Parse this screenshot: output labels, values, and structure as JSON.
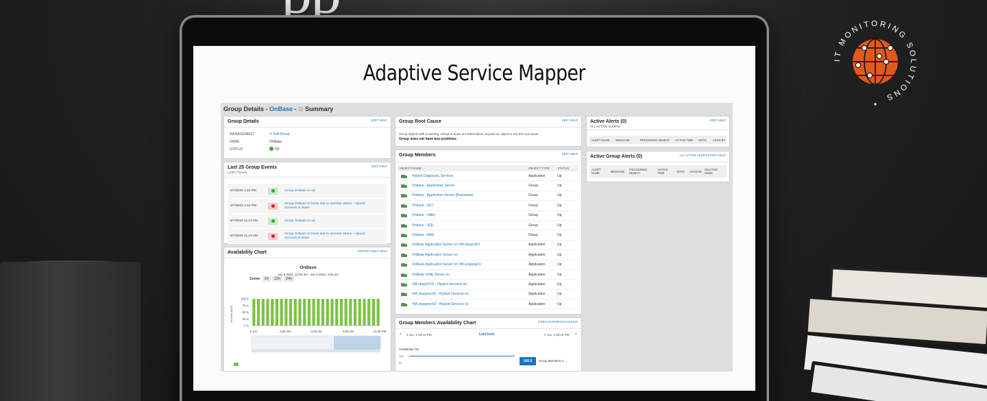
{
  "headline": "Adaptive Service Mapper",
  "bg_text": "pp",
  "logo": {
    "text": "IT MONITORING SOLUTIONS",
    "accent": "#e2591c"
  },
  "dashboard": {
    "title_prefix": "Group Details - ",
    "title_group": "OnBase",
    "title_sep": " - ",
    "title_suffix": "Summary",
    "group_details": {
      "title": "Group Details",
      "actions": "EDIT  HELP",
      "rows": [
        {
          "key": "MANAGEMENT",
          "value": "Edit Group"
        },
        {
          "key": "NAME",
          "value": "OnBase"
        },
        {
          "key": "STATUS",
          "value": "Up"
        }
      ]
    },
    "events": {
      "title": "Last 25 Group Events",
      "subtitle": "LAST 7 DAYS",
      "actions": "EDIT  HELP",
      "items": [
        {
          "time": "6/7/2024 1:18 PM",
          "state": "up",
          "message": "Group OnBase is Up."
        },
        {
          "time": "6/7/2024 1:14 PM",
          "state": "down",
          "message": "Group OnBase is Down due to member status - Hyland Services is Down"
        },
        {
          "time": "6/7/2024 11:23 AM",
          "state": "up",
          "message": "Group OnBase is Up."
        },
        {
          "time": "6/7/2024 11:19 AM",
          "state": "down",
          "message": "Group OnBase is Down due to member status - Hyland Services is Down"
        }
      ]
    },
    "availability": {
      "title": "Availability Chart",
      "actions": "EXPORT  EDIT  HELP",
      "chart_title": "OnBase",
      "range": "Jun 9 2024, 12:00 am - Jun 9 2024, 2:00 pm",
      "zoom_label": "Zoom",
      "zoom_options": [
        "1h",
        "12h",
        "24h"
      ],
      "y_label": "% AVAILABLE"
    },
    "root_cause": {
      "title": "Group Root Cause",
      "actions": "EDIT  HELP",
      "text": "Group objects with a warning, critical or down are listed below. Expand an object to see the root cause.",
      "status": "Group does not have any problems"
    },
    "members": {
      "title": "Group Members",
      "actions": "EDIT  HELP",
      "columns": [
        "OBJECT NAME",
        "OBJECT TYPE",
        "STATUS"
      ],
      "rows": [
        {
          "name": "Hyland Diagnostic Services",
          "type": "Application",
          "status": "Up"
        },
        {
          "name": "Onbase - Application Server",
          "type": "Group",
          "status": "Up"
        },
        {
          "name": "Onbase - Application Server (Brainware)",
          "type": "Group",
          "status": "Up"
        },
        {
          "name": "Onbase - NLT",
          "type": "Group",
          "status": "Up"
        },
        {
          "name": "Onbase - Utility",
          "type": "Group",
          "status": "Up"
        },
        {
          "name": "Onbase - SQL",
          "type": "Group",
          "status": "Up"
        },
        {
          "name": "Onbase - Web",
          "type": "Group",
          "status": "Up"
        },
        {
          "name": "OnBase Application Server on VM-obsprut01",
          "type": "Application",
          "status": "Up"
        },
        {
          "name": "OnBase Application Server on",
          "type": "Application",
          "status": "Up"
        },
        {
          "name": "OnBase Application Server on VM-onsprap01",
          "type": "Application",
          "status": "Up"
        },
        {
          "name": "OnBase Utility Server on",
          "type": "Application",
          "status": "Up"
        },
        {
          "name": "VM-obsphIT01 - Hyland Services on",
          "type": "Application",
          "status": "Up"
        },
        {
          "name": "VM-obspproc01 - Hyland Services on",
          "type": "Application",
          "status": "Up"
        },
        {
          "name": "VM-obspproc02 - Hyland Services on",
          "type": "Application",
          "status": "Up"
        }
      ]
    },
    "members_chart": {
      "title": "Group Members Availability Chart",
      "actions": "OPEN IN PERFSTACK  EDIT",
      "left_time": "9 Jun, 1:08:15 PM",
      "center": "Last hour",
      "right_time": "9 Jun, 2:08:15 PM",
      "y_title": "Availability (%)",
      "y_ticks": [
        "100",
        "50"
      ],
      "badge": "100.0",
      "legend": "Group Members A..."
    },
    "active_alerts": {
      "title": "Active Alerts (0)",
      "subtitle": "ALL ACTIVE ALERTS",
      "actions": "EDIT  HELP",
      "columns": [
        "ALERT NAME",
        "MESSAGE",
        "TRIGGERING OBJECT",
        "ACTIVE TIME",
        "NOTE",
        "ACKD BY"
      ]
    },
    "group_alerts": {
      "title": "Active Group Alerts (0)",
      "actions": "ALL ACTIVE ALERTS  EDIT  HELP",
      "columns": [
        "ALERT NAME",
        "MESSAGE",
        "TRIGGERING OBJECT",
        "ACTIVE TIME",
        "NOTE",
        "ACKD BY",
        "RELATED NODE"
      ]
    }
  },
  "chart_data": {
    "type": "bar",
    "title": "OnBase",
    "ylabel": "% AVAILABLE",
    "ylim": [
      0,
      100
    ],
    "y_ticks": [
      "100 %",
      "75 %",
      "50 %",
      "25 %",
      "0 %"
    ],
    "x_ticks": [
      "9 Jun",
      "3:00 AM",
      "6:00 AM",
      "9:00 AM",
      "12:00 PM"
    ],
    "values": [
      100,
      100,
      100,
      100,
      100,
      100,
      100,
      100,
      100,
      100,
      100,
      100,
      100,
      100,
      100,
      100,
      100,
      100,
      100,
      100,
      100,
      100,
      100,
      100,
      100,
      100,
      100,
      100
    ],
    "color": "#7cc242"
  }
}
